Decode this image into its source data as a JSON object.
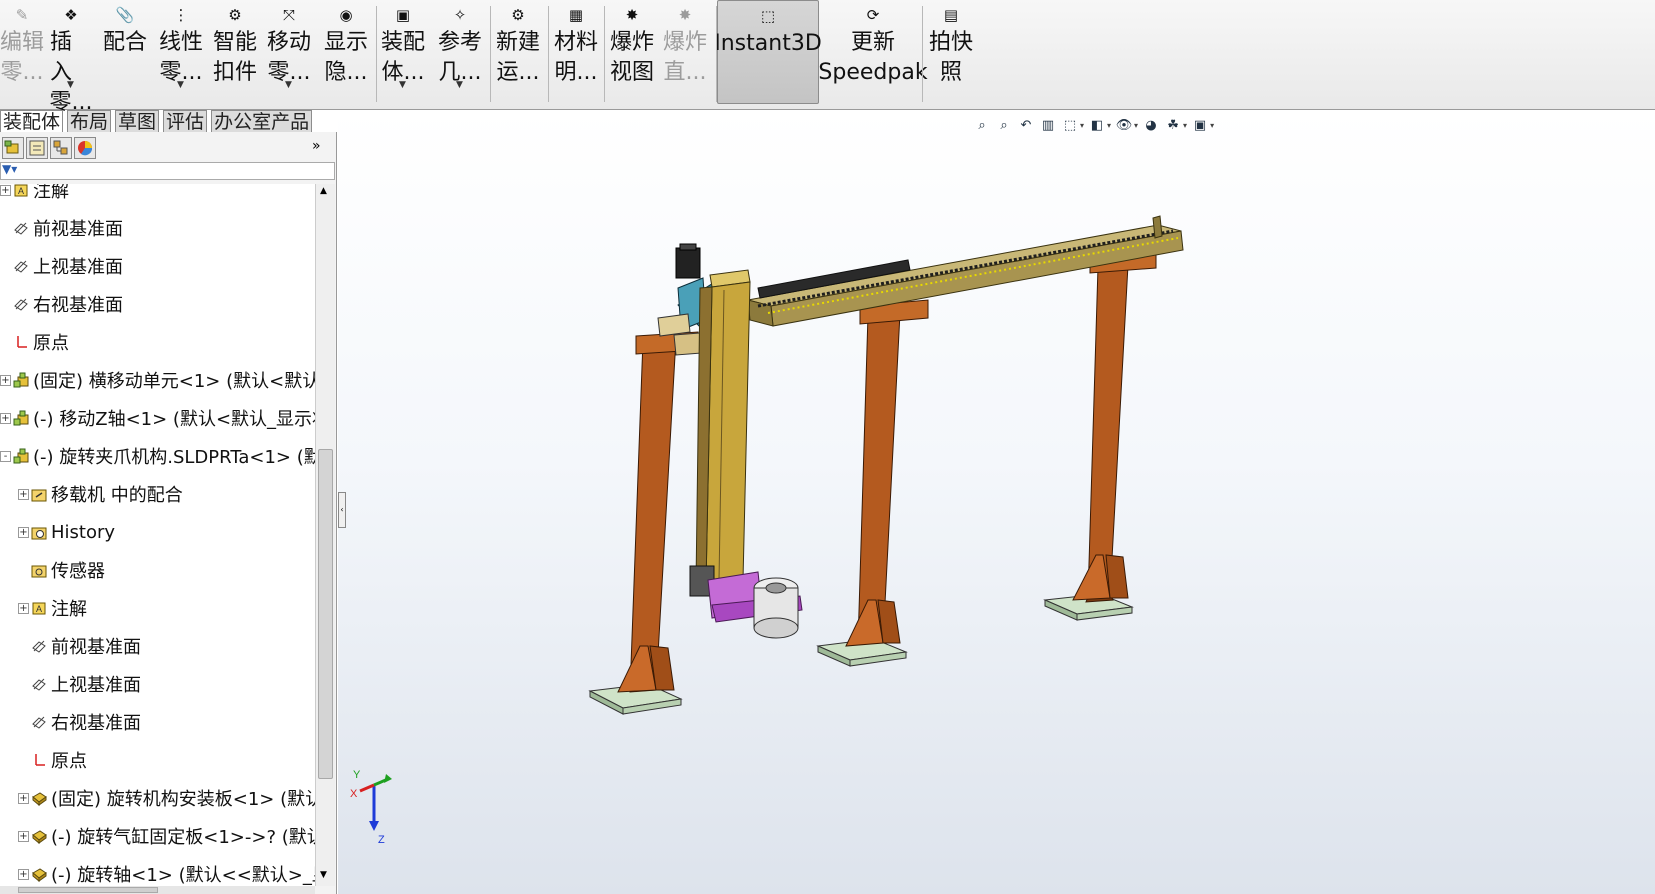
{
  "ribbon": {
    "buttons": [
      {
        "id": "edit-part",
        "line1": "编辑",
        "line2": "零...",
        "disabled": true,
        "icon": "✎"
      },
      {
        "id": "insert-component",
        "line1": "插入",
        "line2": "零...",
        "disabled": false,
        "icon": "❖",
        "dropdown": true
      },
      {
        "id": "mate",
        "line1": "配合",
        "line2": "",
        "disabled": false,
        "icon": "📎"
      },
      {
        "id": "linear-pattern",
        "line1": "线性",
        "line2": "零...",
        "disabled": false,
        "icon": "⋮",
        "dropdown": true
      },
      {
        "id": "smart-fasteners",
        "line1": "智能",
        "line2": "扣件",
        "disabled": false,
        "icon": "⚙"
      },
      {
        "id": "move-component",
        "line1": "移动",
        "line2": "零...",
        "disabled": false,
        "icon": "⤧",
        "dropdown": true
      },
      {
        "id": "show-hidden",
        "line1": "显示",
        "line2": "隐...",
        "disabled": false,
        "icon": "◉"
      },
      {
        "id": "assembly-features",
        "line1": "装配",
        "line2": "体...",
        "disabled": false,
        "icon": "▣",
        "dropdown": true
      },
      {
        "id": "reference-geometry",
        "line1": "参考",
        "line2": "几...",
        "disabled": false,
        "icon": "✧",
        "dropdown": true
      },
      {
        "id": "new-motion-study",
        "line1": "新建",
        "line2": "运...",
        "disabled": false,
        "icon": "⚙"
      },
      {
        "id": "bill-of-materials",
        "line1": "材料",
        "line2": "明...",
        "disabled": false,
        "icon": "▦"
      },
      {
        "id": "exploded-view",
        "line1": "爆炸",
        "line2": "视图",
        "disabled": false,
        "icon": "✸"
      },
      {
        "id": "explode-line-sketch",
        "line1": "爆炸",
        "line2": "直...",
        "disabled": true,
        "icon": "✸"
      },
      {
        "id": "instant3d",
        "line1": "Instant3D",
        "line2": "",
        "disabled": false,
        "icon": "⬚",
        "active": true
      },
      {
        "id": "update-speedpak",
        "line1": "更新",
        "line2": "Speedpak",
        "disabled": false,
        "icon": "⟳"
      },
      {
        "id": "take-snapshot",
        "line1": "拍快",
        "line2": "照",
        "disabled": false,
        "icon": "▤"
      }
    ]
  },
  "tabs": [
    "装配体",
    "布局",
    "草图",
    "评估",
    "办公室产品"
  ],
  "tree": {
    "items": [
      {
        "label": "注解",
        "icon": "annotation-icon",
        "expand": "+",
        "indent": 0
      },
      {
        "label": "前视基准面",
        "icon": "plane-icon",
        "expand": "",
        "indent": 0
      },
      {
        "label": "上视基准面",
        "icon": "plane-icon",
        "expand": "",
        "indent": 0
      },
      {
        "label": "右视基准面",
        "icon": "plane-icon",
        "expand": "",
        "indent": 0
      },
      {
        "label": "原点",
        "icon": "origin-icon",
        "expand": "",
        "indent": 0
      },
      {
        "label": "(固定) 横移动单元<1> (默认<默认_",
        "icon": "subassembly-icon",
        "expand": "+",
        "indent": 0
      },
      {
        "label": "(-) 移动Z轴<1> (默认<默认_显示状",
        "icon": "subassembly-icon",
        "expand": "+",
        "indent": 0
      },
      {
        "label": "(-) 旋转夹爪机构.SLDPRTa<1> (默",
        "icon": "subassembly-icon",
        "expand": "-",
        "indent": 0
      },
      {
        "label": "移载机 中的配合",
        "icon": "mates-folder-icon",
        "expand": "+",
        "indent": 1
      },
      {
        "label": "History",
        "icon": "history-icon",
        "expand": "+",
        "indent": 1
      },
      {
        "label": "传感器",
        "icon": "sensor-icon",
        "expand": "",
        "indent": 1
      },
      {
        "label": "注解",
        "icon": "annotation-icon",
        "expand": "+",
        "indent": 1
      },
      {
        "label": "前视基准面",
        "icon": "plane-icon",
        "expand": "",
        "indent": 1
      },
      {
        "label": "上视基准面",
        "icon": "plane-icon",
        "expand": "",
        "indent": 1
      },
      {
        "label": "右视基准面",
        "icon": "plane-icon",
        "expand": "",
        "indent": 1
      },
      {
        "label": "原点",
        "icon": "origin-icon",
        "expand": "",
        "indent": 1
      },
      {
        "label": "(固定) 旋转机构安装板<1> (默认",
        "icon": "part-icon",
        "expand": "+",
        "indent": 1
      },
      {
        "label": "(-) 旋转气缸固定板<1>->? (默认",
        "icon": "part-icon",
        "expand": "+",
        "indent": 1
      },
      {
        "label": "(-) 旋转轴<1> (默认<<默认>_显",
        "icon": "part-icon",
        "expand": "+",
        "indent": 1
      }
    ]
  },
  "triad": {
    "x": "X",
    "y": "Y",
    "z": "Z"
  },
  "colors": {
    "leg": "#b45a1f",
    "beam": "#a89450",
    "beam_top": "#c9b877",
    "base_plate": "#cfe3c8",
    "gripper": "#c46bd6",
    "motor_block": "#2d7d9a"
  }
}
